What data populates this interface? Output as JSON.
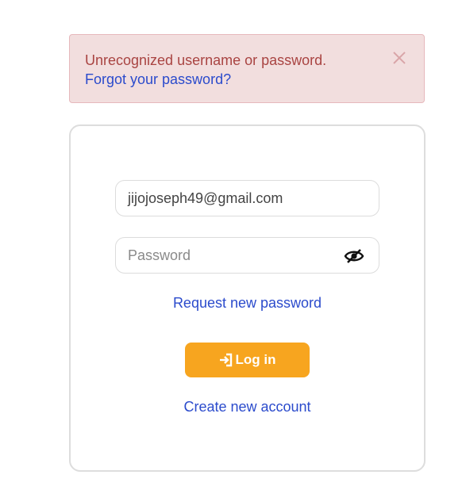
{
  "alert": {
    "message": "Unrecognized username or password.",
    "forgot_link": "Forgot your password?",
    "close_icon": "close-icon",
    "background_color": "#f2dede",
    "text_color": "#a94442"
  },
  "login_form": {
    "email_value": "jijojoseph49@gmail.com",
    "password_placeholder": "Password",
    "password_toggle_icon": "eye-slash-icon",
    "request_password_link": "Request new password",
    "login_button_label": "Log in",
    "login_button_icon": "sign-in-icon",
    "create_account_link": "Create new account",
    "accent_color": "#f7a51f",
    "link_color": "#2b4bcc"
  }
}
